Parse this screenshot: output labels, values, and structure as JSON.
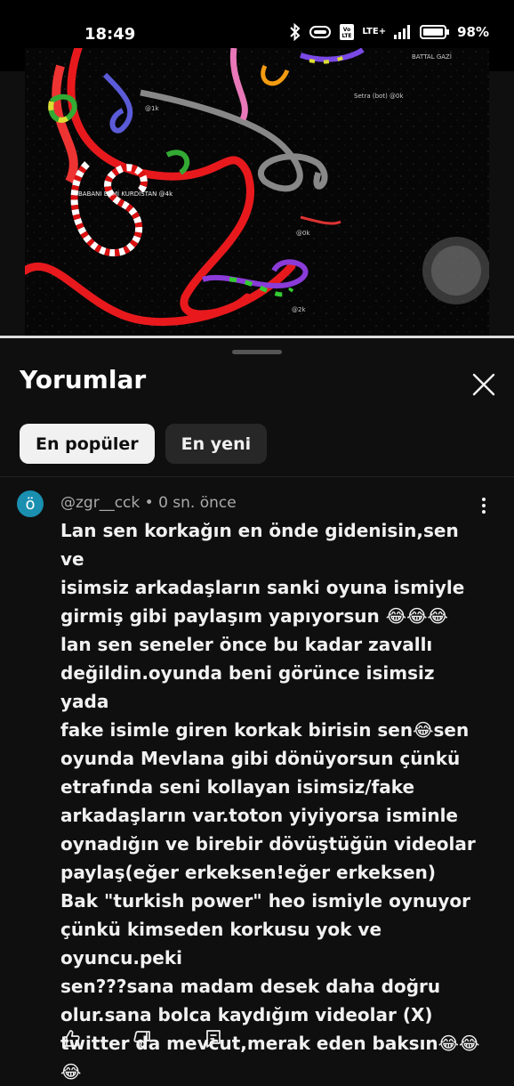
{
  "status_bar": {
    "time": "18:49",
    "network": "LTE+",
    "battery": "98%"
  },
  "video": {
    "player_name_right": "BATTAL GAZİ",
    "labels": [
      "Setra (bot) @0k",
      "BABANI EÇMİ KURDİSTAN @4k",
      "@0k",
      "@1k",
      "@2k"
    ],
    "progress_fraction": 1.0
  },
  "comments_sheet": {
    "title": "Yorumlar",
    "chips": [
      "En popüler",
      "En yeni"
    ],
    "comment": {
      "avatar_letter": "ö",
      "meta": "@zgr__cck • 0 sn. önce",
      "text": "Lan sen korkağın en önde gidenisin,sen ve\nisimsiz arkadaşların sanki oyuna ismiyle\ngirmiş gibi paylaşım yapıyorsun 😂😂😂\nlan sen seneler önce bu kadar zavallı\ndeğildin.oyunda beni görünce isimsiz yada\nfake isimle giren korkak birisin sen😂sen\noyunda Mevlana gibi dönüyorsun çünkü\netrafında seni kollayan isimsiz/fake\narkadaşların var.toton yiyiyorsa isminle\noynadığın ve birebir dövüştüğün videolar\npaylaş(eğer erkeksen!eğer erkeksen)\nBak \"turkish power\" heo ismiyle oynuyor\nçünkü kimseden korkusu yok ve oyuncu.peki\nsen???sana madam desek daha doğru\nolur.sana bolca kaydığım videolar (X)\ntwitter da mevcut,merak eden baksın😂😂\n😂"
    }
  },
  "icons": [
    "bluetooth-icon",
    "vibrate-icon",
    "volte-icon",
    "signal-icon",
    "battery-icon",
    "close-icon",
    "more-vert-icon",
    "like-icon",
    "dislike-icon",
    "reply-icon"
  ]
}
